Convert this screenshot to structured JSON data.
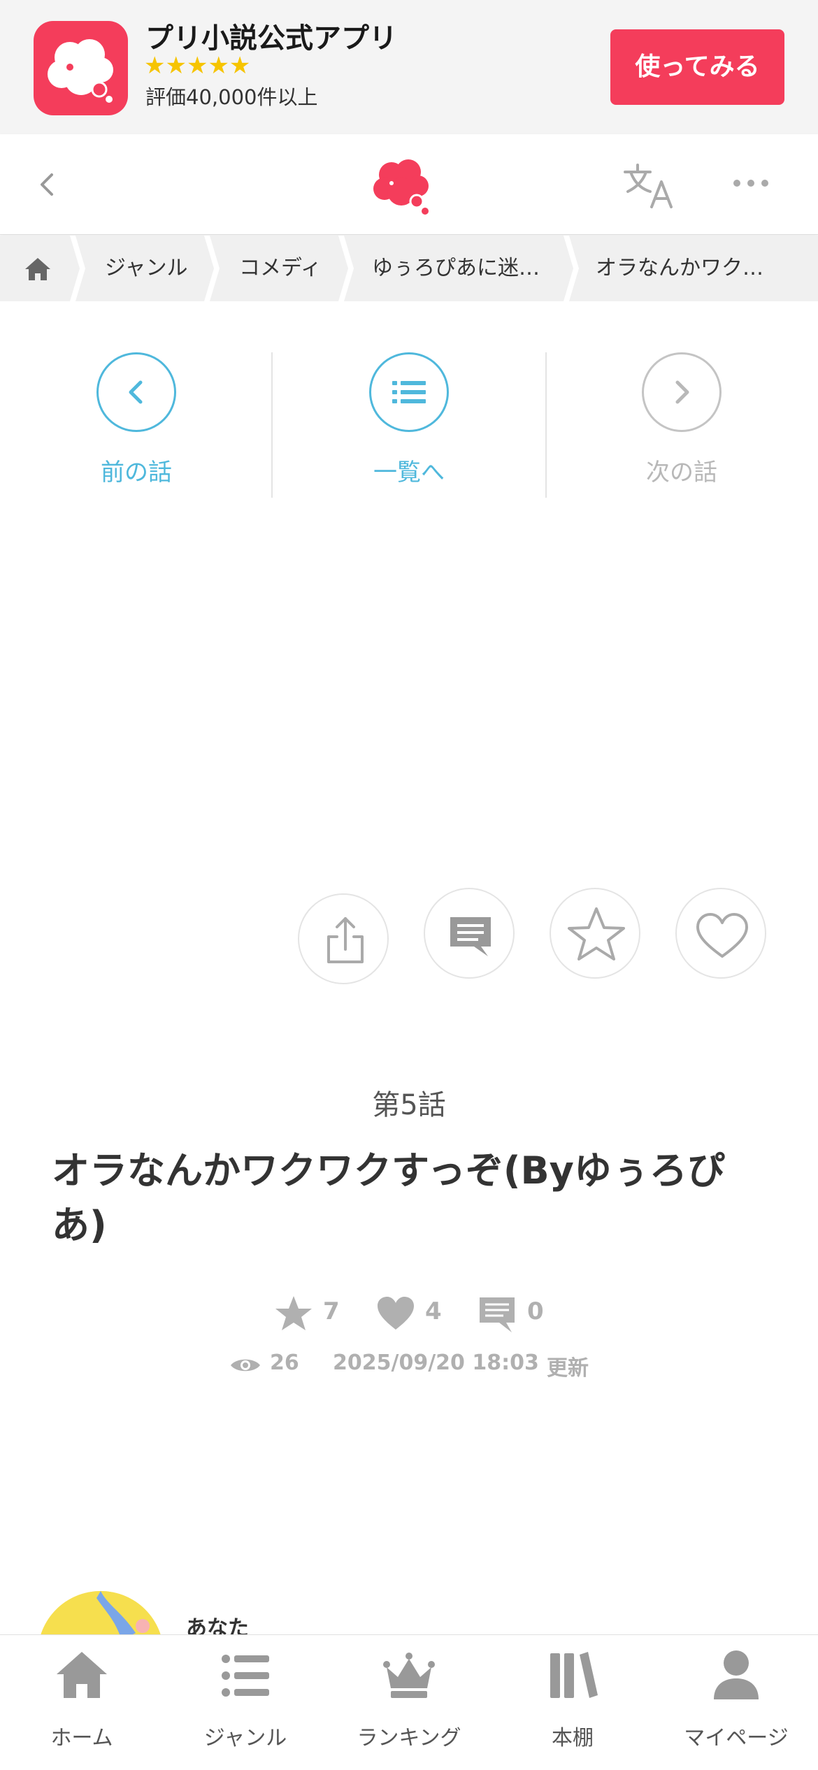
{
  "promo": {
    "title": "プリ小説公式アプリ",
    "stars": "★★★★★",
    "rating_text": "評価40,000件以上",
    "cta_label": "使ってみる",
    "brand_color": "#f43d5b"
  },
  "header": {
    "back_icon": "chevron-left-icon",
    "logo_icon": "cloud-logo-icon",
    "translate_icon": "translate-icon",
    "more_icon": "more-dots-icon"
  },
  "breadcrumb": {
    "items": [
      "ジャンル",
      "コメディ",
      "ゆぅろぴあに迷…",
      "オラなんかワク…"
    ]
  },
  "episode_nav": {
    "prev_label": "前の話",
    "list_label": "一覧へ",
    "next_label": "次の話",
    "accent_color": "#4fb8dc",
    "disabled_color": "#b8b8b8"
  },
  "actions": [
    "share-icon",
    "comment-icon",
    "star-icon",
    "heart-icon"
  ],
  "episode": {
    "number": "第5話",
    "title": "オラなんかワクワクすっぞ(Byゆぅろぴあ)"
  },
  "stats": {
    "stars": "7",
    "hearts": "4",
    "comments": "0",
    "views": "26",
    "updated": "2025/09/20 18:03",
    "updated_suffix": "更新"
  },
  "author": {
    "name": "あなた"
  },
  "tabbar": {
    "items": [
      {
        "label": "ホーム",
        "icon": "home-icon"
      },
      {
        "label": "ジャンル",
        "icon": "list-icon"
      },
      {
        "label": "ランキング",
        "icon": "crown-icon"
      },
      {
        "label": "本棚",
        "icon": "bookshelf-icon"
      },
      {
        "label": "マイページ",
        "icon": "person-icon"
      }
    ]
  }
}
